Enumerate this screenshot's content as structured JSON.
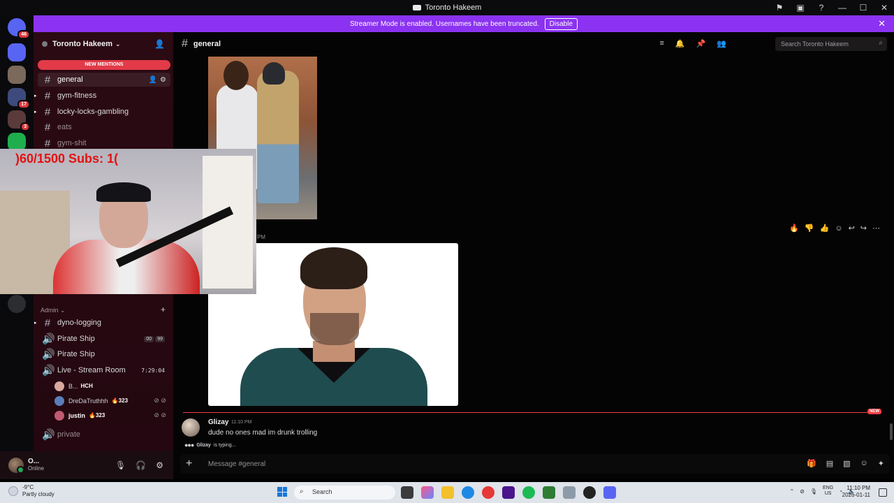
{
  "window": {
    "title": "Toronto Hakeem",
    "controls": [
      "⚑",
      "▣",
      "?",
      "—",
      "☐",
      "✕"
    ]
  },
  "banner": {
    "text": "Streamer Mode is enabled. Usernames have been truncated.",
    "button": "Disable"
  },
  "guilds": {
    "home_badge": "46",
    "badges": [
      "17",
      "3"
    ]
  },
  "server": {
    "name": "Toronto Hakeem",
    "new_mentions": "NEW MENTIONS"
  },
  "channels": [
    {
      "name": "general"
    },
    {
      "name": "gym-fitness"
    },
    {
      "name": "locky-locks-gambling"
    },
    {
      "name": "eats"
    },
    {
      "name": "gym-shit"
    }
  ],
  "category": {
    "name": "Admin"
  },
  "admin_channels": {
    "dyno": "dyno-logging",
    "pirate1": "Pirate Ship",
    "pirate1_pills": [
      "00",
      "99"
    ],
    "pirate2": "Pirate Ship",
    "live": "Live - Stream Room",
    "live_time": "7:29:04",
    "private": "private"
  },
  "voice_users": [
    {
      "name": "B...",
      "tag": "HCH",
      "fire": ""
    },
    {
      "name": "DreDaTruthhh",
      "fire": "323"
    },
    {
      "name": "justin",
      "fire": "323"
    }
  ],
  "user_panel": {
    "name": "O...",
    "status": "Online"
  },
  "main": {
    "channel": "general",
    "search_placeholder": "Search Toronto Hakeem",
    "partial_time": "PM",
    "new_tag": "NEW"
  },
  "message": {
    "author": "Glizay",
    "time": "11:10 PM",
    "text": "dude no ones mad im drunk trolling",
    "typing_user": "Glizay",
    "typing_suffix": "is typing..."
  },
  "composer": {
    "placeholder": "Message #general"
  },
  "webcam": {
    "overlay_text": ")60/1500  Subs: 1("
  },
  "taskbar": {
    "temp": "-9°C",
    "weather": "Partly cloudy",
    "search": "Search",
    "lang_top": "ENG",
    "lang_bottom": "US",
    "time": "11:10 PM",
    "date": "2026-01-11"
  }
}
